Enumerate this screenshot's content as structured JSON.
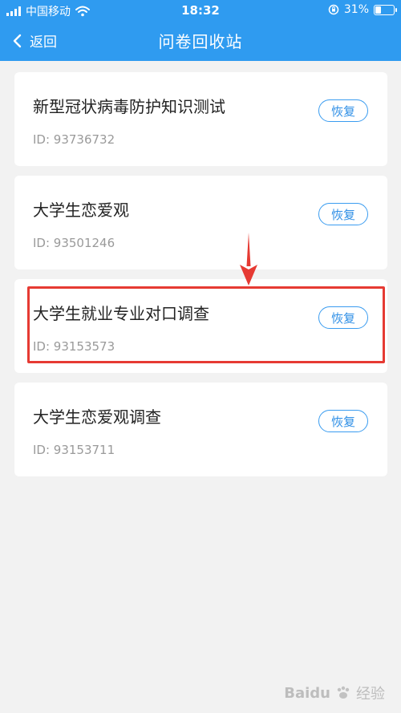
{
  "status_bar": {
    "carrier": "中国移动",
    "time": "18:32",
    "battery": "31%",
    "battery_level": 0.31
  },
  "nav": {
    "back_label": "返回",
    "title": "问卷回收站"
  },
  "restore_label": "恢复",
  "surveys": [
    {
      "title": "新型冠状病毒防护知识测试",
      "id": "ID: 93736732"
    },
    {
      "title": "大学生恋爱观",
      "id": "ID: 93501246"
    },
    {
      "title": "大学生就业专业对口调查",
      "id": "ID: 93153573"
    },
    {
      "title": "大学生恋爱观调查",
      "id": "ID: 93153711"
    }
  ],
  "watermark": {
    "logo_text": "Baidu",
    "text": "经验"
  },
  "colors": {
    "header": "#2f9bf0",
    "accent": "#3a9cf0",
    "highlight": "#e63a33",
    "background": "#f2f2f2"
  }
}
